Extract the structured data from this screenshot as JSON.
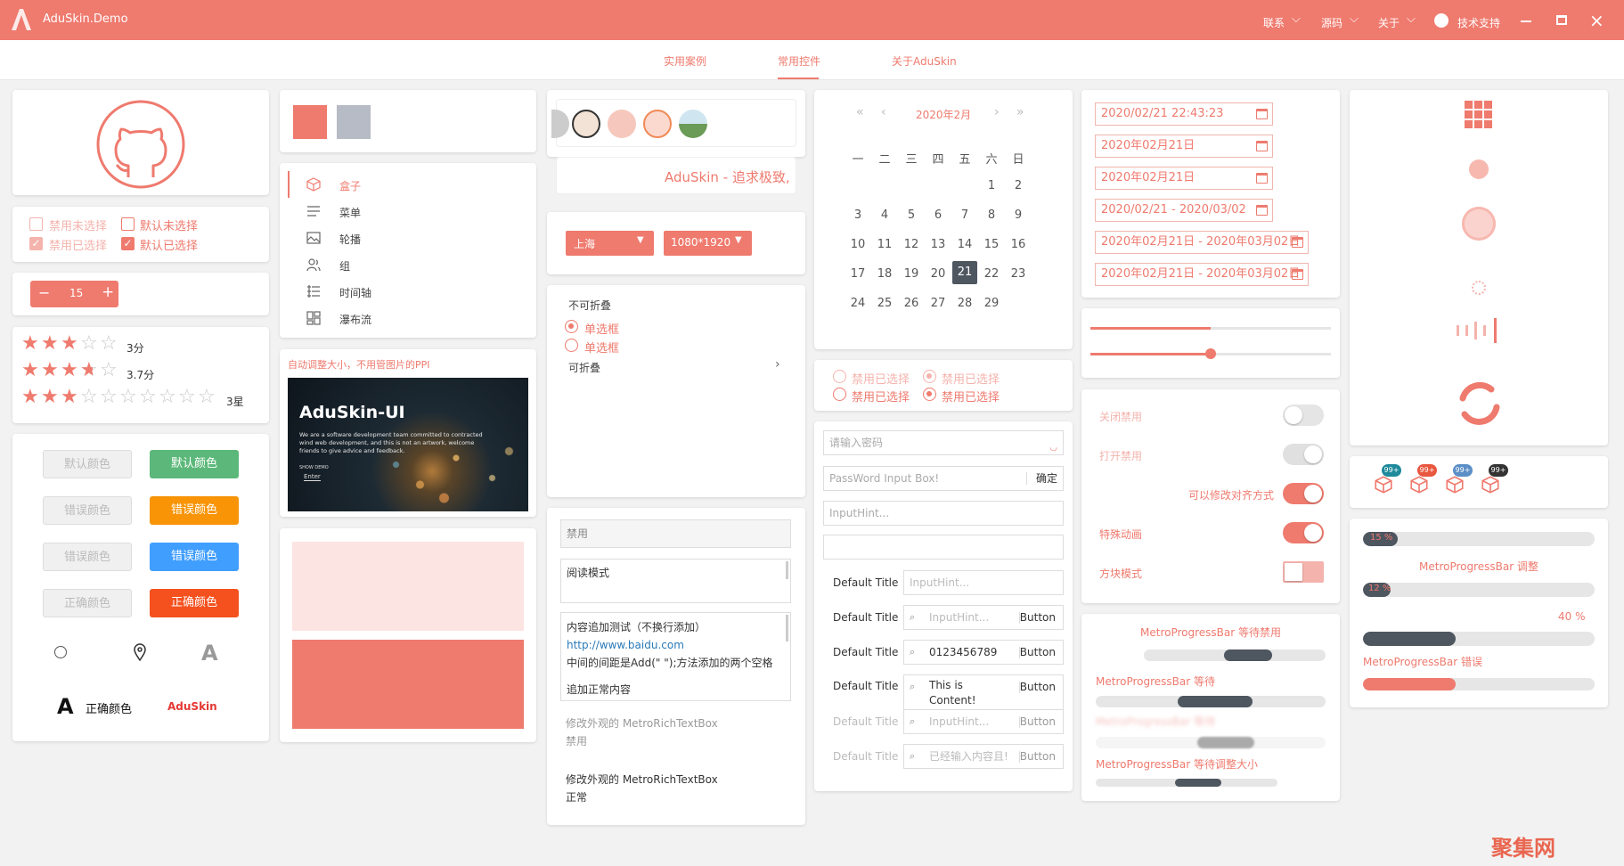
{
  "colors": {
    "accent": "#ef7a6e",
    "accent_light": "#f4b3ac",
    "green": "#5cb87a",
    "orange": "#f89406",
    "blue": "#409eff",
    "red": "#f4511e",
    "dark": "#4e5660"
  },
  "window": {
    "app_logo": "A",
    "title": "AduSkin.Demo",
    "menu": [
      {
        "label": "联系"
      },
      {
        "label": "源码"
      },
      {
        "label": "关于"
      }
    ],
    "support_label": "技术支持",
    "controls": [
      "minimize-icon",
      "maximize-icon",
      "close-icon"
    ]
  },
  "tabs": [
    {
      "label": "实用案例"
    },
    {
      "label": "常用控件"
    },
    {
      "label": "关于AduSkin"
    }
  ],
  "checkboxes": [
    {
      "label": "禁用未选择"
    },
    {
      "label": "默认未选择"
    },
    {
      "label": "禁用已选择"
    },
    {
      "label": "默认已选择"
    }
  ],
  "stepper": {
    "minus": "−",
    "value": "15",
    "plus": "+"
  },
  "ratings": [
    {
      "stars": 3,
      "max": 5,
      "label": "3分"
    },
    {
      "stars": 3.7,
      "max": 5,
      "label": "3.7分"
    },
    {
      "stars": 3,
      "max": 10,
      "label": "3星"
    }
  ],
  "buttons": {
    "rows": [
      [
        "默认颜色",
        "默认颜色"
      ],
      [
        "错误颜色",
        "错误颜色"
      ],
      [
        "错误颜色",
        "错误颜色"
      ],
      [
        "正确颜色",
        "正确颜色"
      ]
    ]
  },
  "logos": {
    "brand_text": "正确颜色",
    "brand_small": "AduSkin",
    "brand_letter": "A"
  },
  "swatches": [
    "#ef7a6e",
    "#b7bbc6"
  ],
  "side_menu": [
    {
      "label": "盒子",
      "icon": "box-icon"
    },
    {
      "label": "菜单",
      "icon": "menu-icon"
    },
    {
      "label": "轮播",
      "icon": "carousel-icon"
    },
    {
      "label": "组",
      "icon": "group-icon"
    },
    {
      "label": "时间轴",
      "icon": "timeline-icon"
    },
    {
      "label": "瀑布流",
      "icon": "waterfall-icon"
    }
  ],
  "image_card": {
    "caption": "自动调整大小，不用管图片的PPI",
    "title": "AduSkin-UI",
    "body": "We are a software development team committed to contracted wind web development, and this is not an artwork, welcome friends to give advice and feedback.",
    "show": "SHOW DEMO",
    "enter": "Enter"
  },
  "marquee": {
    "text": "AduSkin - 追求极致,"
  },
  "dropdowns": [
    {
      "value": "上海"
    },
    {
      "value": "1080*1920"
    }
  ],
  "expander": {
    "header": "不可折叠",
    "radio1": "单选框",
    "radio2": "单选框",
    "collapsible": "可折叠"
  },
  "textboxes": {
    "disabled": "禁用",
    "readonly": "阅读模式",
    "rich_lines": [
      "内容追加测试（不换行添加）",
      "http://www.baidu.com",
      "中间的间距是Add(\"  \");方法添加的两个空格",
      "追加正常内容"
    ],
    "rich_disabled_label": "修改外观的 MetroRichTextBox",
    "rich_disabled_state": "禁用",
    "rich_normal_label": "修改外观的 MetroRichTextBox",
    "rich_normal_state": "正常"
  },
  "calendar": {
    "month": "2020年2月",
    "weekdays": [
      "一",
      "二",
      "三",
      "四",
      "五",
      "六",
      "日"
    ],
    "weeks": [
      [
        "",
        "",
        "",
        "",
        "",
        "1",
        "2"
      ],
      [
        "3",
        "4",
        "5",
        "6",
        "7",
        "8",
        "9"
      ],
      [
        "10",
        "11",
        "12",
        "13",
        "14",
        "15",
        "16"
      ],
      [
        "17",
        "18",
        "19",
        "20",
        "21",
        "22",
        "23"
      ],
      [
        "24",
        "25",
        "26",
        "27",
        "28",
        "29",
        ""
      ]
    ],
    "selected": "21"
  },
  "radios": [
    {
      "label": "禁用已选择"
    },
    {
      "label": "禁用已选择"
    },
    {
      "label": "禁用已选择"
    },
    {
      "label": "禁用已选择"
    }
  ],
  "inputs": {
    "password_hint": "请输入密码",
    "password_box": "PassWord Input Box!",
    "confirm": "确定",
    "hint": "InputHint...",
    "rows": [
      {
        "title": "Default Title",
        "placeholder": "InputHint...",
        "button": ""
      },
      {
        "title": "Default Title",
        "placeholder": "InputHint...",
        "button": "Button"
      },
      {
        "title": "Default Title",
        "value": "0123456789",
        "button": "Button"
      },
      {
        "title": "Default Title",
        "value": "This is Content!",
        "button": "Button"
      },
      {
        "title": "Default Title",
        "placeholder": "InputHint...",
        "button": "Button"
      },
      {
        "title": "Default Title",
        "placeholder": "已经输入内容且!",
        "button": "Button"
      }
    ]
  },
  "datepickers": [
    "2020/02/21 22:43:23",
    "2020年02月21日",
    "2020年02月21日",
    "2020/02/21 - 2020/03/02",
    "2020年02月21日 - 2020年03月02日",
    "2020年02月21日 - 2020年03月02日"
  ],
  "sliders": [
    {
      "value": 0.5
    },
    {
      "value": 0.5
    }
  ],
  "toggles": [
    {
      "label": "关闭禁用",
      "on": false
    },
    {
      "label": "打开禁用",
      "on": true
    },
    {
      "label": "可以修改对齐方式",
      "on": true
    },
    {
      "label": "特殊动画",
      "on": true
    },
    {
      "label": "方块模式",
      "on": true
    }
  ],
  "loading_bars": {
    "title1": "MetroProgressBar 等待禁用",
    "title2": "MetroProgressBar 等待",
    "title3": "MetroProgressBar 等待",
    "title4": "MetroProgressBar 等待调整大小"
  },
  "badges": [
    {
      "text": "99+",
      "color": "#1f8a9b"
    },
    {
      "text": "99+",
      "color": "#e9573f"
    },
    {
      "text": "99+",
      "color": "#5b8fc7"
    },
    {
      "text": "99+",
      "color": "#333333"
    }
  ],
  "progress": {
    "p1_label": "15 %",
    "p1": 0.15,
    "p1_title": "MetroProgressBar 调整",
    "p2_label": "12 %",
    "p2": 0.12,
    "p3_label": "40 %",
    "p3": 0.4,
    "p4_title": "MetroProgressBar 错误",
    "p4": 0.4
  },
  "watermark": "聚集网"
}
